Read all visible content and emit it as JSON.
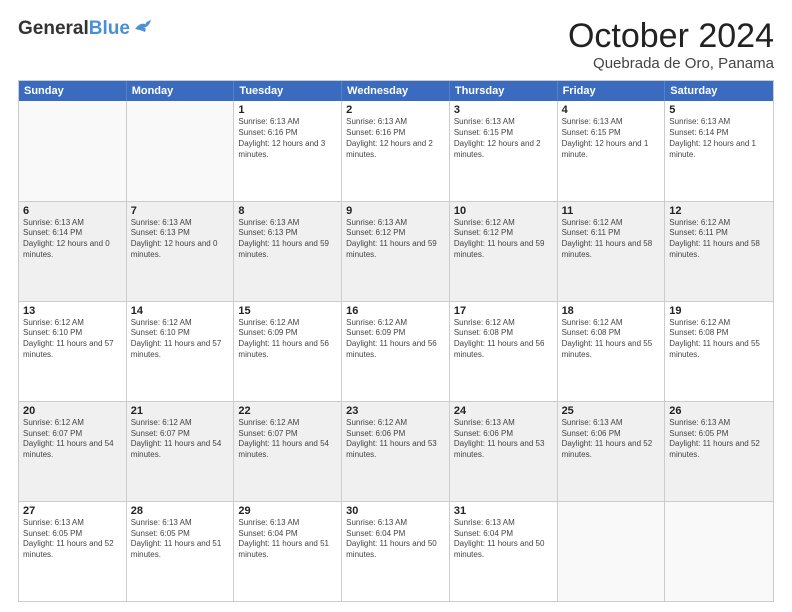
{
  "header": {
    "logo_general": "General",
    "logo_blue": "Blue",
    "month_title": "October 2024",
    "location": "Quebrada de Oro, Panama"
  },
  "days_of_week": [
    "Sunday",
    "Monday",
    "Tuesday",
    "Wednesday",
    "Thursday",
    "Friday",
    "Saturday"
  ],
  "weeks": [
    [
      {
        "day": "",
        "sunrise": "",
        "sunset": "",
        "daylight": "",
        "empty": true
      },
      {
        "day": "",
        "sunrise": "",
        "sunset": "",
        "daylight": "",
        "empty": true
      },
      {
        "day": "1",
        "sunrise": "Sunrise: 6:13 AM",
        "sunset": "Sunset: 6:16 PM",
        "daylight": "Daylight: 12 hours and 3 minutes."
      },
      {
        "day": "2",
        "sunrise": "Sunrise: 6:13 AM",
        "sunset": "Sunset: 6:16 PM",
        "daylight": "Daylight: 12 hours and 2 minutes."
      },
      {
        "day": "3",
        "sunrise": "Sunrise: 6:13 AM",
        "sunset": "Sunset: 6:15 PM",
        "daylight": "Daylight: 12 hours and 2 minutes."
      },
      {
        "day": "4",
        "sunrise": "Sunrise: 6:13 AM",
        "sunset": "Sunset: 6:15 PM",
        "daylight": "Daylight: 12 hours and 1 minute."
      },
      {
        "day": "5",
        "sunrise": "Sunrise: 6:13 AM",
        "sunset": "Sunset: 6:14 PM",
        "daylight": "Daylight: 12 hours and 1 minute."
      }
    ],
    [
      {
        "day": "6",
        "sunrise": "Sunrise: 6:13 AM",
        "sunset": "Sunset: 6:14 PM",
        "daylight": "Daylight: 12 hours and 0 minutes."
      },
      {
        "day": "7",
        "sunrise": "Sunrise: 6:13 AM",
        "sunset": "Sunset: 6:13 PM",
        "daylight": "Daylight: 12 hours and 0 minutes."
      },
      {
        "day": "8",
        "sunrise": "Sunrise: 6:13 AM",
        "sunset": "Sunset: 6:13 PM",
        "daylight": "Daylight: 11 hours and 59 minutes."
      },
      {
        "day": "9",
        "sunrise": "Sunrise: 6:13 AM",
        "sunset": "Sunset: 6:12 PM",
        "daylight": "Daylight: 11 hours and 59 minutes."
      },
      {
        "day": "10",
        "sunrise": "Sunrise: 6:12 AM",
        "sunset": "Sunset: 6:12 PM",
        "daylight": "Daylight: 11 hours and 59 minutes."
      },
      {
        "day": "11",
        "sunrise": "Sunrise: 6:12 AM",
        "sunset": "Sunset: 6:11 PM",
        "daylight": "Daylight: 11 hours and 58 minutes."
      },
      {
        "day": "12",
        "sunrise": "Sunrise: 6:12 AM",
        "sunset": "Sunset: 6:11 PM",
        "daylight": "Daylight: 11 hours and 58 minutes."
      }
    ],
    [
      {
        "day": "13",
        "sunrise": "Sunrise: 6:12 AM",
        "sunset": "Sunset: 6:10 PM",
        "daylight": "Daylight: 11 hours and 57 minutes."
      },
      {
        "day": "14",
        "sunrise": "Sunrise: 6:12 AM",
        "sunset": "Sunset: 6:10 PM",
        "daylight": "Daylight: 11 hours and 57 minutes."
      },
      {
        "day": "15",
        "sunrise": "Sunrise: 6:12 AM",
        "sunset": "Sunset: 6:09 PM",
        "daylight": "Daylight: 11 hours and 56 minutes."
      },
      {
        "day": "16",
        "sunrise": "Sunrise: 6:12 AM",
        "sunset": "Sunset: 6:09 PM",
        "daylight": "Daylight: 11 hours and 56 minutes."
      },
      {
        "day": "17",
        "sunrise": "Sunrise: 6:12 AM",
        "sunset": "Sunset: 6:08 PM",
        "daylight": "Daylight: 11 hours and 56 minutes."
      },
      {
        "day": "18",
        "sunrise": "Sunrise: 6:12 AM",
        "sunset": "Sunset: 6:08 PM",
        "daylight": "Daylight: 11 hours and 55 minutes."
      },
      {
        "day": "19",
        "sunrise": "Sunrise: 6:12 AM",
        "sunset": "Sunset: 6:08 PM",
        "daylight": "Daylight: 11 hours and 55 minutes."
      }
    ],
    [
      {
        "day": "20",
        "sunrise": "Sunrise: 6:12 AM",
        "sunset": "Sunset: 6:07 PM",
        "daylight": "Daylight: 11 hours and 54 minutes."
      },
      {
        "day": "21",
        "sunrise": "Sunrise: 6:12 AM",
        "sunset": "Sunset: 6:07 PM",
        "daylight": "Daylight: 11 hours and 54 minutes."
      },
      {
        "day": "22",
        "sunrise": "Sunrise: 6:12 AM",
        "sunset": "Sunset: 6:07 PM",
        "daylight": "Daylight: 11 hours and 54 minutes."
      },
      {
        "day": "23",
        "sunrise": "Sunrise: 6:12 AM",
        "sunset": "Sunset: 6:06 PM",
        "daylight": "Daylight: 11 hours and 53 minutes."
      },
      {
        "day": "24",
        "sunrise": "Sunrise: 6:13 AM",
        "sunset": "Sunset: 6:06 PM",
        "daylight": "Daylight: 11 hours and 53 minutes."
      },
      {
        "day": "25",
        "sunrise": "Sunrise: 6:13 AM",
        "sunset": "Sunset: 6:06 PM",
        "daylight": "Daylight: 11 hours and 52 minutes."
      },
      {
        "day": "26",
        "sunrise": "Sunrise: 6:13 AM",
        "sunset": "Sunset: 6:05 PM",
        "daylight": "Daylight: 11 hours and 52 minutes."
      }
    ],
    [
      {
        "day": "27",
        "sunrise": "Sunrise: 6:13 AM",
        "sunset": "Sunset: 6:05 PM",
        "daylight": "Daylight: 11 hours and 52 minutes."
      },
      {
        "day": "28",
        "sunrise": "Sunrise: 6:13 AM",
        "sunset": "Sunset: 6:05 PM",
        "daylight": "Daylight: 11 hours and 51 minutes."
      },
      {
        "day": "29",
        "sunrise": "Sunrise: 6:13 AM",
        "sunset": "Sunset: 6:04 PM",
        "daylight": "Daylight: 11 hours and 51 minutes."
      },
      {
        "day": "30",
        "sunrise": "Sunrise: 6:13 AM",
        "sunset": "Sunset: 6:04 PM",
        "daylight": "Daylight: 11 hours and 50 minutes."
      },
      {
        "day": "31",
        "sunrise": "Sunrise: 6:13 AM",
        "sunset": "Sunset: 6:04 PM",
        "daylight": "Daylight: 11 hours and 50 minutes."
      },
      {
        "day": "",
        "sunrise": "",
        "sunset": "",
        "daylight": "",
        "empty": true
      },
      {
        "day": "",
        "sunrise": "",
        "sunset": "",
        "daylight": "",
        "empty": true
      }
    ]
  ]
}
